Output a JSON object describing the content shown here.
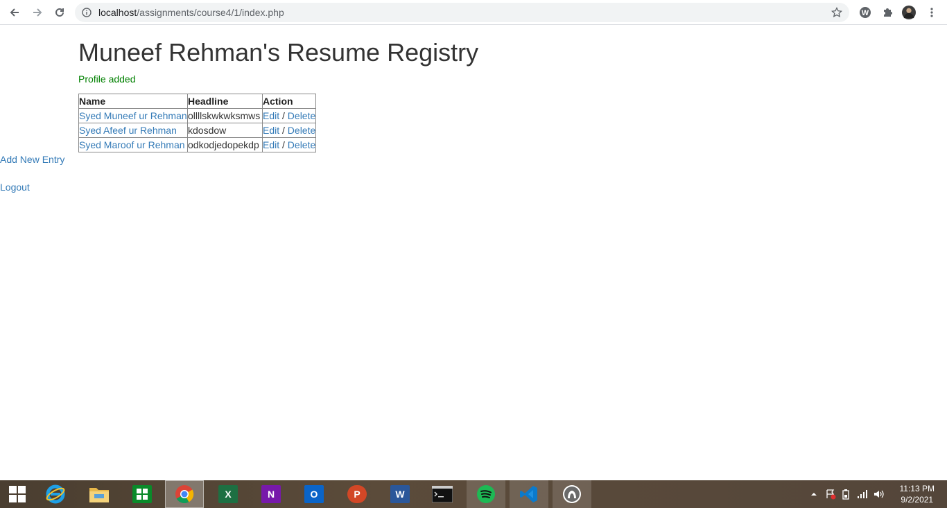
{
  "browser": {
    "url_host": "localhost",
    "url_path": "/assignments/course4/1/index.php"
  },
  "page": {
    "title": "Muneef Rehman's Resume Registry",
    "flash": "Profile added",
    "table": {
      "headers": [
        "Name",
        "Headline",
        "Action"
      ],
      "rows": [
        {
          "name": "Syed Muneef ur Rehman",
          "headline": "ollllskwkwksmws",
          "edit": "Edit",
          "sep": "/",
          "delete": "Delete"
        },
        {
          "name": "Syed Afeef ur Rehman",
          "headline": "kdosdow",
          "edit": "Edit",
          "sep": "/",
          "delete": "Delete"
        },
        {
          "name": "Syed Maroof ur Rehman",
          "headline": "odkodjedopekdp",
          "edit": "Edit",
          "sep": "/",
          "delete": "Delete"
        }
      ]
    },
    "add_link": "Add New Entry",
    "logout_link": "Logout"
  },
  "taskbar": {
    "apps": [
      "start-icon",
      "internet-explorer-icon",
      "file-explorer-icon",
      "store-icon",
      "chrome-icon",
      "excel-icon",
      "onenote-icon",
      "outlook-icon",
      "powerpoint-icon",
      "word-icon",
      "cmd-icon",
      "spotify-icon",
      "vscode-icon",
      "app-icon"
    ],
    "time": "11:13 PM",
    "date": "9/2/2021"
  },
  "colors": {
    "link": "#337ab7",
    "flash": "#008000",
    "title": "#333333"
  }
}
